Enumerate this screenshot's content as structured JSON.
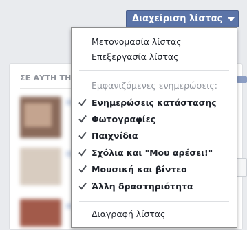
{
  "header": {
    "manage_button_label": "Διαχείριση λίστας"
  },
  "background": {
    "section_title": "ΣΕ ΑΥΤΗ ΤΗ"
  },
  "menu": {
    "actions": [
      {
        "label": "Μετονομασία λίστας"
      },
      {
        "label": "Επεξεργασία λίστας"
      }
    ],
    "updates_header": "Εμφανιζόμενες ενημερώσεις:",
    "updates": [
      {
        "label": "Ενημερώσεις κατάστασης",
        "checked": true
      },
      {
        "label": "Φωτογραφίες",
        "checked": true
      },
      {
        "label": "Παιχνίδια",
        "checked": true
      },
      {
        "label": "Σχόλια και \"Μου αρέσει!\"",
        "checked": true
      },
      {
        "label": "Μουσική και βίντεο",
        "checked": true
      },
      {
        "label": "Άλλη δραστηριότητα",
        "checked": true
      }
    ],
    "delete_label": "Διαγραφή λίστας"
  },
  "colors": {
    "button_bg": "#5b74a8",
    "check_color": "#4b4f56"
  }
}
